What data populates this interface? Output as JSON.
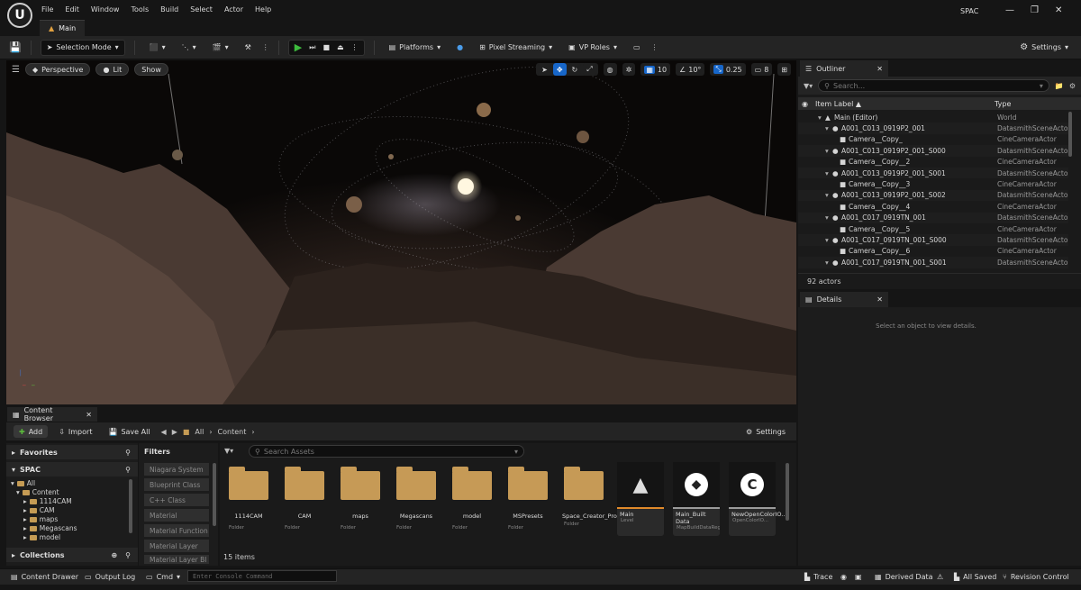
{
  "menu": [
    "File",
    "Edit",
    "Window",
    "Tools",
    "Build",
    "Select",
    "Actor",
    "Help"
  ],
  "app_title": "SPAC",
  "main_tab": "Main",
  "toolbar": {
    "selection_mode": "Selection Mode",
    "platforms": "Platforms",
    "pixel_streaming": "Pixel Streaming",
    "vp_roles": "VP Roles",
    "settings": "Settings"
  },
  "viewport": {
    "perspective": "Perspective",
    "lit": "Lit",
    "show": "Show",
    "grid_snap": "10",
    "rot_snap": "10°",
    "scale_snap": "0.25",
    "camera_speed": "8"
  },
  "outliner": {
    "tab": "Outliner",
    "search_placeholder": "Search...",
    "col_label": "Item Label ▲",
    "col_type": "Type",
    "rows": [
      {
        "label": "Main (Editor)",
        "type": "World",
        "indent": 0
      },
      {
        "label": "A001_C013_0919P2_001",
        "type": "DatasmithSceneActo",
        "indent": 1
      },
      {
        "label": "Camera__Copy_",
        "type": "CineCameraActor",
        "indent": 2
      },
      {
        "label": "A001_C013_0919P2_001_S000",
        "type": "DatasmithSceneActo",
        "indent": 1
      },
      {
        "label": "Camera__Copy__2",
        "type": "CineCameraActor",
        "indent": 2
      },
      {
        "label": "A001_C013_0919P2_001_S001",
        "type": "DatasmithSceneActo",
        "indent": 1
      },
      {
        "label": "Camera__Copy__3",
        "type": "CineCameraActor",
        "indent": 2
      },
      {
        "label": "A001_C013_0919P2_001_S002",
        "type": "DatasmithSceneActo",
        "indent": 1
      },
      {
        "label": "Camera__Copy__4",
        "type": "CineCameraActor",
        "indent": 2
      },
      {
        "label": "A001_C017_0919TN_001",
        "type": "DatasmithSceneActo",
        "indent": 1
      },
      {
        "label": "Camera__Copy__5",
        "type": "CineCameraActor",
        "indent": 2
      },
      {
        "label": "A001_C017_0919TN_001_S000",
        "type": "DatasmithSceneActo",
        "indent": 1
      },
      {
        "label": "Camera__Copy__6",
        "type": "CineCameraActor",
        "indent": 2
      },
      {
        "label": "A001_C017_0919TN_001_S001",
        "type": "DatasmithSceneActo",
        "indent": 1
      }
    ],
    "status": "92 actors"
  },
  "details": {
    "tab": "Details",
    "empty": "Select an object to view details."
  },
  "content_browser": {
    "tab": "Content Browser",
    "add": "Add",
    "import": "Import",
    "save_all": "Save All",
    "path_all": "All",
    "path_content": "Content",
    "settings": "Settings",
    "favorites": "Favorites",
    "project": "SPAC",
    "collections": "Collections",
    "tree": [
      "All",
      "Content",
      "1114CAM",
      "CAM",
      "maps",
      "Megascans",
      "model"
    ],
    "filters_label": "Filters",
    "filters": [
      "Niagara System",
      "Blueprint Class",
      "C++ Class",
      "Material",
      "Material Function",
      "Material Layer",
      "Material Layer Bl"
    ],
    "search_placeholder": "Search Assets",
    "folders": [
      {
        "name": "1114CAM",
        "type": "Folder"
      },
      {
        "name": "CAM",
        "type": "Folder"
      },
      {
        "name": "maps",
        "type": "Folder"
      },
      {
        "name": "Megascans",
        "type": "Folder"
      },
      {
        "name": "model",
        "type": "Folder"
      },
      {
        "name": "MSPresets",
        "type": "Folder"
      },
      {
        "name": "Space_Creator_Pro",
        "type": "Folder"
      }
    ],
    "assets": [
      {
        "name": "Main",
        "type": "Level"
      },
      {
        "name": "Main_Built Data",
        "type": "MapBuildDataRegistry"
      },
      {
        "name": "NewOpenColorIO...",
        "type": "OpenColorIO..."
      }
    ],
    "items": "15 items"
  },
  "statusbar": {
    "content_drawer": "Content Drawer",
    "output_log": "Output Log",
    "cmd": "Cmd",
    "console_placeholder": "Enter Console Command",
    "trace": "Trace",
    "derived_data": "Derived Data",
    "all_saved": "All Saved",
    "revision_control": "Revision Control"
  }
}
